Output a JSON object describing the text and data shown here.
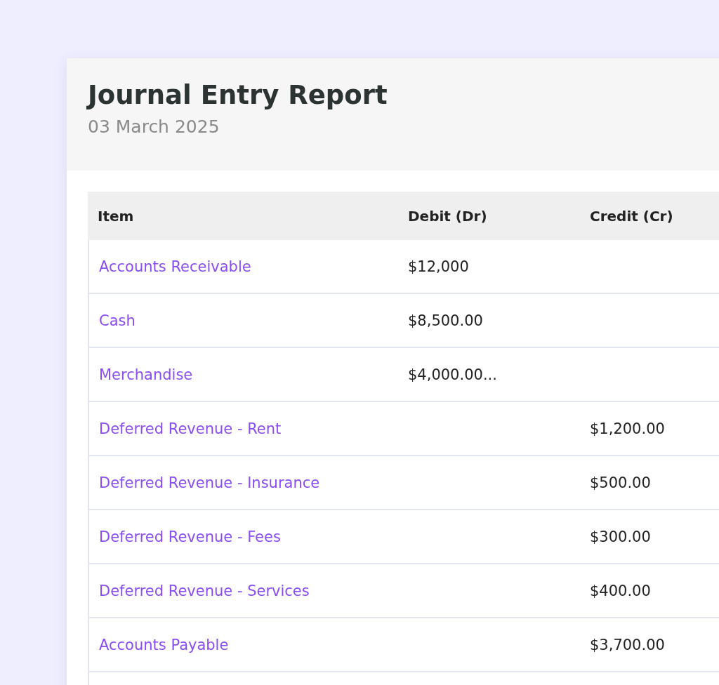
{
  "report": {
    "title": "Journal Entry Report",
    "date": "03 March 2025"
  },
  "table": {
    "columns": [
      "Item",
      "Debit (Dr)",
      "Credit (Cr)"
    ],
    "rows": [
      {
        "item": "Accounts Receivable",
        "debit": "$12,000"
      },
      {
        "item": "Cash",
        "debit": "$8,500.00"
      },
      {
        "item": "Merchandise",
        "debit": "$4,000.00..."
      },
      {
        "item": "Deferred Revenue - Rent",
        "credit": "$1,200.00"
      },
      {
        "item": "Deferred Revenue - Insurance",
        "credit": "$500.00"
      },
      {
        "item": "Deferred Revenue - Fees",
        "credit": "$300.00"
      },
      {
        "item": "Deferred Revenue - Services",
        "credit": "$400.00"
      },
      {
        "item": "Accounts Payable",
        "credit": "$3,700.00"
      }
    ]
  }
}
